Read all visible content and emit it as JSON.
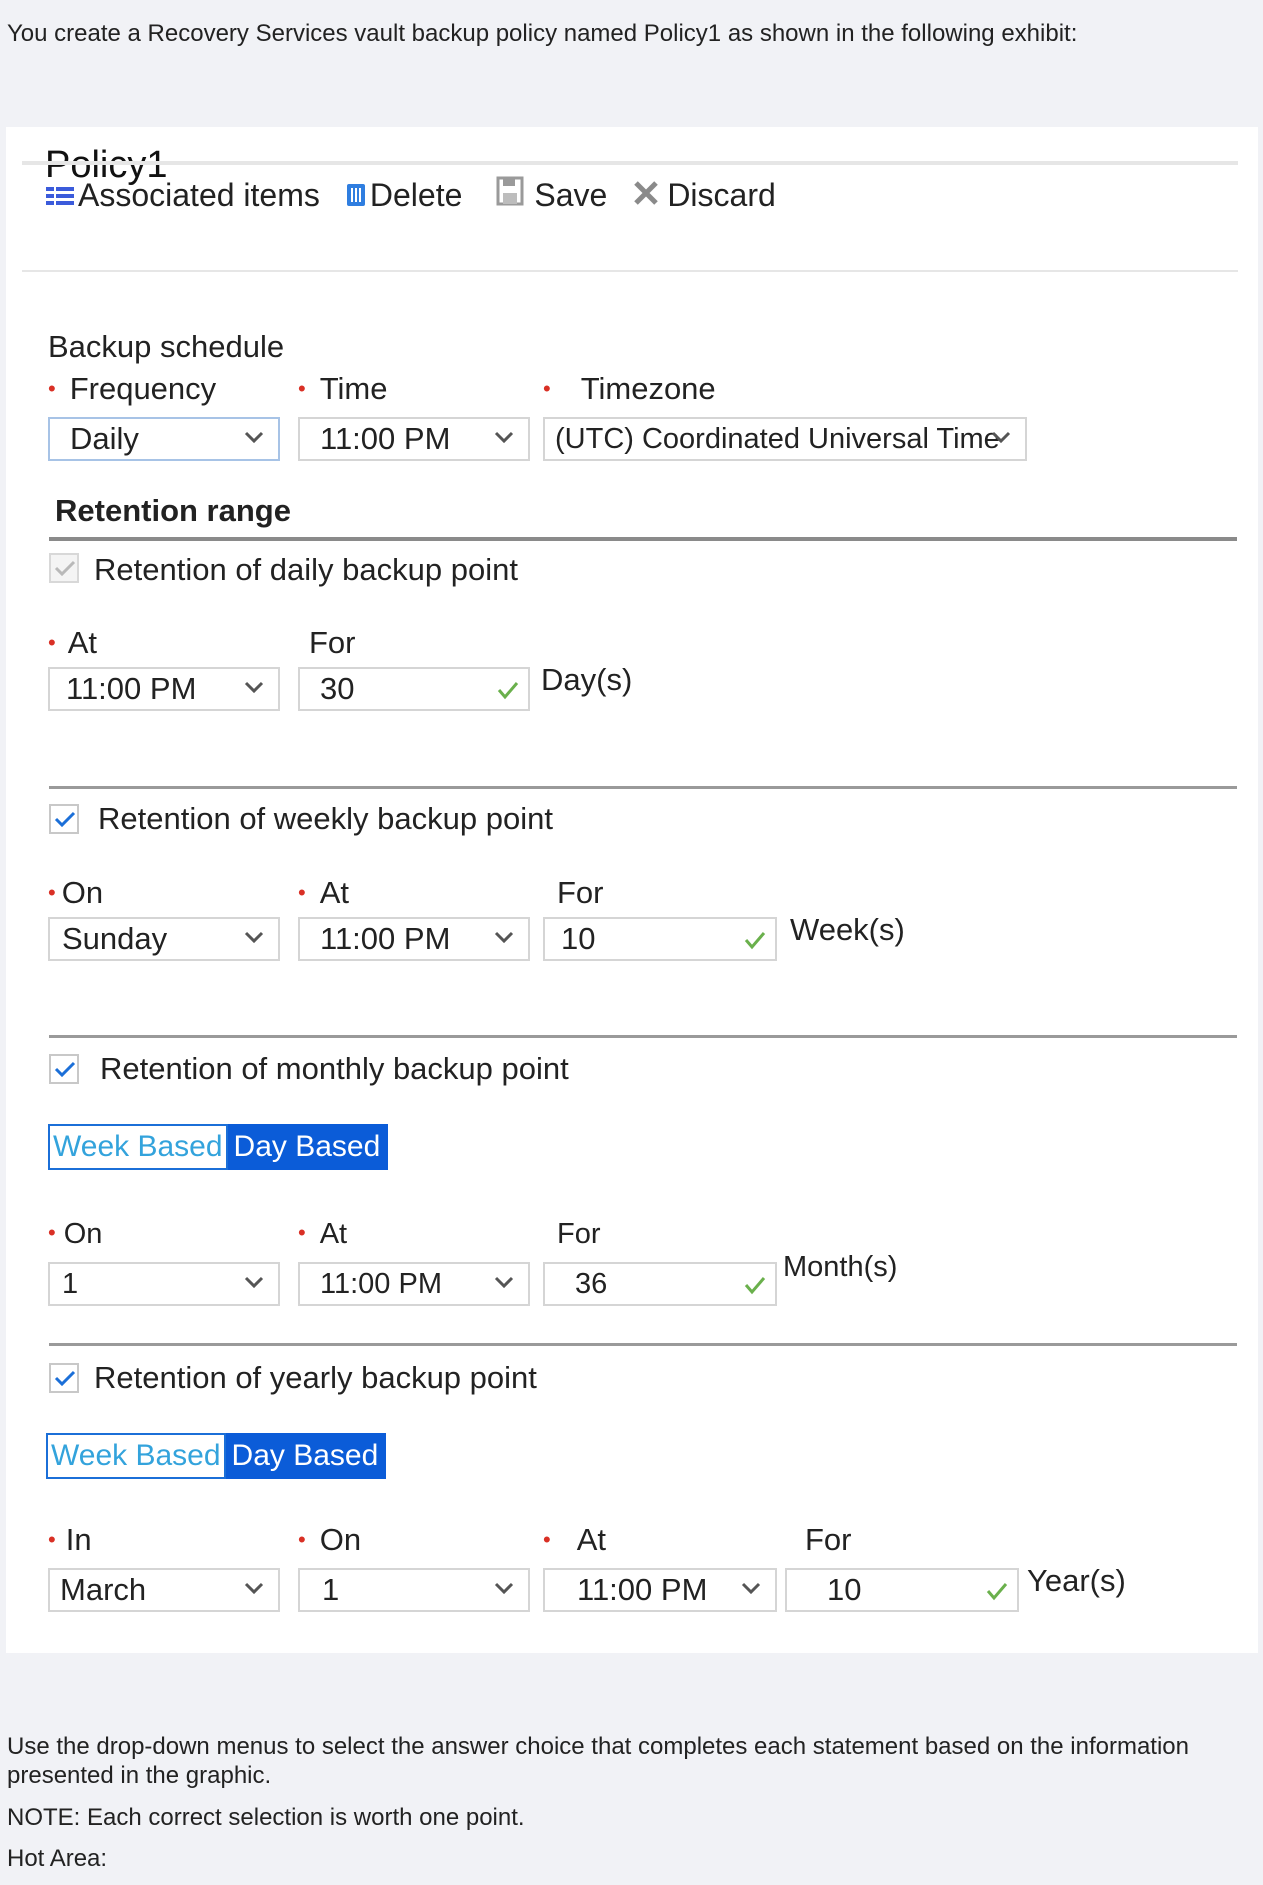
{
  "intro": "You create a Recovery Services vault backup policy named Policy1 as shown in the following exhibit:",
  "policy": {
    "title": "Policy1",
    "toolbar": {
      "associated": "Associated items",
      "delete": "Delete",
      "save": "Save",
      "discard": "Discard"
    },
    "schedule": {
      "heading": "Backup schedule",
      "frequency_label": "Frequency",
      "frequency": "Daily",
      "time_label": "Time",
      "time": "11:00 PM",
      "timezone_label": "Timezone",
      "timezone": "(UTC) Coordinated Universal Time"
    },
    "retention_heading": "Retention range",
    "daily": {
      "label": "Retention of daily backup point",
      "at_label": "At",
      "at": "11:00 PM",
      "for_label": "For",
      "for": "30",
      "unit": "Day(s)"
    },
    "weekly": {
      "label": "Retention of weekly backup point",
      "on_label": "On",
      "on": "Sunday",
      "at_label": "At",
      "at": "11:00 PM",
      "for_label": "For",
      "for": "10",
      "unit": "Week(s)"
    },
    "monthly": {
      "label": "Retention of monthly backup point",
      "toggle_week": "Week Based",
      "toggle_day": "Day Based",
      "on_label": "On",
      "on": "1",
      "at_label": "At",
      "at": "11:00 PM",
      "for_label": "For",
      "for": "36",
      "unit": "Month(s)"
    },
    "yearly": {
      "label": "Retention of yearly backup point",
      "toggle_week": "Week Based",
      "toggle_day": "Day Based",
      "in_label": "In",
      "in": "March",
      "on_label": "On",
      "on": "1",
      "at_label": "At",
      "at": "11:00 PM",
      "for_label": "For",
      "for": "10",
      "unit": "Year(s)"
    }
  },
  "outro": {
    "instruction": "Use the drop-down menus to select the answer choice that completes each statement based on the information presented in the graphic.",
    "note": "NOTE: Each correct selection is worth one point.",
    "hot_area": "Hot Area:"
  },
  "colors": {
    "required": "#d93025",
    "toggle_active": "#0b5cd8",
    "checkmark_ok": "#6ab04c",
    "checkbox_check": "#1b6fd8"
  }
}
